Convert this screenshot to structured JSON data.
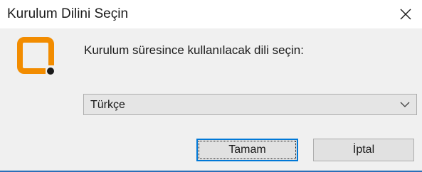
{
  "window": {
    "title": "Kurulum Dilini Seçin",
    "close_icon": "close-icon"
  },
  "dialog": {
    "message": "Kurulum süresince kullanılacak dili seçin:",
    "logo_icon": "installer-logo-icon",
    "language_select": {
      "selected": "Türkçe",
      "chevron_icon": "chevron-down-icon"
    },
    "buttons": {
      "ok_label": "Tamam",
      "cancel_label": "İptal"
    }
  },
  "colors": {
    "logo_orange": "#f28c00",
    "logo_dot": "#1a1a1a",
    "focus_blue": "#0078d7",
    "body_bg": "#f0f0f0"
  }
}
